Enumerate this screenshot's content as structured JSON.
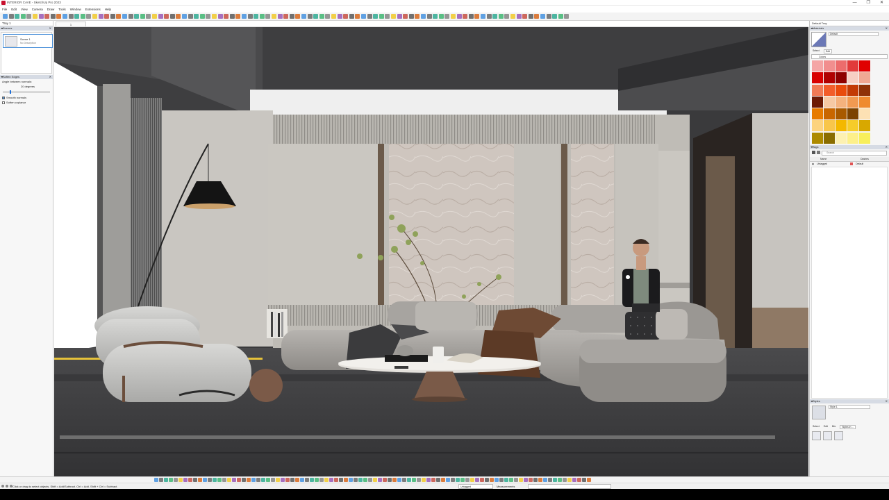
{
  "window": {
    "title": "INTERIOR CAVE - SketchUp Pro 2023",
    "buttons": [
      "—",
      "❐",
      "✕"
    ]
  },
  "menu": [
    "File",
    "Edit",
    "View",
    "Camera",
    "Draw",
    "Tools",
    "Window",
    "Extensions",
    "Help"
  ],
  "left_panel": {
    "tab": "Tray 1",
    "scenes": {
      "header": "Scenes",
      "scene_name": "Scene 1",
      "scene_desc": "No Description"
    },
    "soften": {
      "header": "Soften Edges",
      "angle_label": "Angle between normals:",
      "angle_value": "20  degrees",
      "options": [
        {
          "label": "Smooth normals",
          "checked": true
        },
        {
          "label": "Soften coplanar",
          "checked": false
        }
      ]
    }
  },
  "viewport": {
    "tab_label": "1"
  },
  "right_panel": {
    "tab": "Default Tray",
    "materials": {
      "header": "Materials",
      "current": "Default",
      "sub_tabs": [
        "Select",
        "Edit"
      ],
      "library": "Colors",
      "swatches": [
        "#f4a5a5",
        "#f18e8e",
        "#ec6c6c",
        "#e13a3a",
        "#e00000",
        "#d80000",
        "#b00000",
        "#8e0000",
        "#f7cfc4",
        "#f0a893",
        "#f07a55",
        "#f25d2a",
        "#e94b0c",
        "#c23a05",
        "#8e3208",
        "#6d1b05",
        "#f6c9a4",
        "#f4b27e",
        "#f19a52",
        "#ef8b30",
        "#e77b00",
        "#c96600",
        "#a85900",
        "#7c4200",
        "#fde1b4",
        "#fcd37e",
        "#f8c64a",
        "#f4b800",
        "#f6cc2a",
        "#d8a800",
        "#ad8a00",
        "#8a6d00",
        "#fdf1b2",
        "#fdf08a",
        "#f8ef5b"
      ]
    },
    "tags": {
      "header": "Tags",
      "search_placeholder": "Search",
      "columns": [
        "Name",
        "Dashes"
      ],
      "rows": [
        {
          "name": "Untagged",
          "dashes": "Default",
          "color": "#e05555"
        }
      ]
    },
    "styles": {
      "header": "Styles",
      "name": "Style 1",
      "sub_tabs": [
        "Select",
        "Edit",
        "Mix"
      ],
      "library": "Styles in ..."
    }
  },
  "status": {
    "message": "Click or drag to select objects. Shift = Add/Subtract. Ctrl = Add. Shift + Ctrl = Subtract.",
    "tag_selector": "Untagged",
    "measurements_label": "Measurements"
  }
}
